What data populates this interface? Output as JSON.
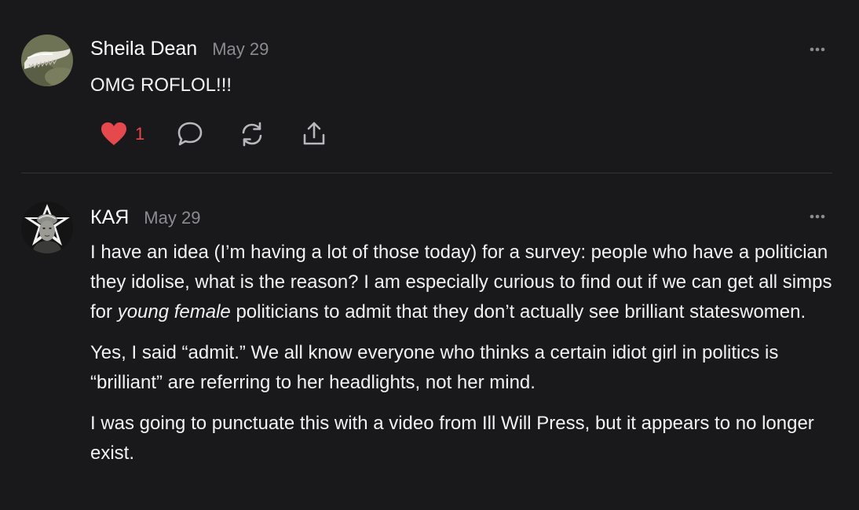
{
  "comments": [
    {
      "author": "Sheila Dean",
      "date": "May 29",
      "body": "OMG ROFLOL!!!",
      "likes": "1",
      "liked": true,
      "avatar_icon": "jaw-bone-avatar"
    },
    {
      "author": "КАЯ",
      "date": "May 29",
      "avatar_icon": "portrait-avatar",
      "paragraphs": [
        {
          "before": "I have an idea (I’m having a lot of those today) for a survey: people who have a politician they idolise, what is the reason? I am especially curious to find out if we can get all simps for ",
          "emphasis": "young female",
          "after": " politicians to admit that they don’t actually see brilliant stateswomen."
        },
        {
          "text": "Yes, I said “admit.” We all know everyone who thinks a certain idiot girl in politics is “brilliant” are referring to her headlights, not her mind."
        },
        {
          "text": "I was going to punctuate this with a video from Ill Will Press, but it appears to no longer exist."
        }
      ]
    }
  ],
  "colors": {
    "background": "#19191b",
    "heart": "#e5484d",
    "muted": "#8c8c90",
    "icon": "#b8b8bc"
  }
}
